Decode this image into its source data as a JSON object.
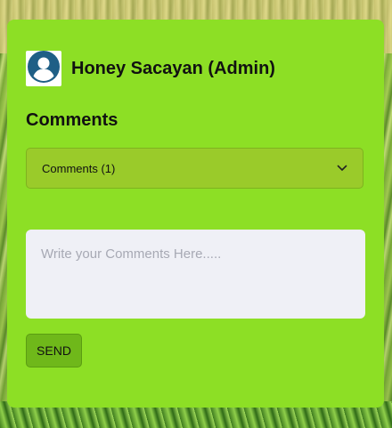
{
  "user": {
    "name": "Honey Sacayan (Admin)",
    "avatar_icon": "user-avatar-icon"
  },
  "comments": {
    "title": "Comments",
    "accordion_label": "Comments (1)",
    "accordion_icon": "chevron-down-icon",
    "input_placeholder": "Write your Comments Here.....",
    "input_value": "",
    "send_label": "SEND"
  },
  "colors": {
    "card_background": "#8ddf25",
    "accordion_background": "#9acb2a",
    "send_button": "#6fb81a",
    "avatar_blue": "#1f5f86"
  }
}
